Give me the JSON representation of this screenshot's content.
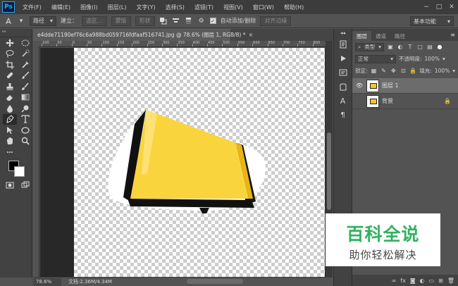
{
  "app": {
    "logo": "Ps",
    "menu": [
      "文件(F)",
      "编辑(E)",
      "图像(I)",
      "图层(L)",
      "文字(Y)",
      "选择(S)",
      "滤镜(T)",
      "视图(V)",
      "窗口(W)",
      "帮助(H)"
    ],
    "window_controls": [
      "−",
      "□",
      "✕"
    ]
  },
  "options_bar": {
    "tool_mode": "路径",
    "make_label": "建立：",
    "selection_btn": "选区...",
    "mask_btn": "蒙版",
    "shape_btn": "形状",
    "auto_add_delete": "自动添加/删除",
    "align_edges": "对齐边缘",
    "workspace": "基本功能"
  },
  "document": {
    "tab_title": "e4dde71190ef76c6a988bd059716fdfaaf516741.jpg @ 78.6% (图层 1, RGB/8) *",
    "zoom": "78.6%",
    "doc_info": "文档:2.36M/4.34M"
  },
  "ruler_ticks": [
    "100",
    "50",
    "0",
    "50",
    "100",
    "150",
    "200",
    "250",
    "300",
    "350",
    "400",
    "450",
    "500",
    "550",
    "600",
    "650",
    "700",
    "750",
    "800"
  ],
  "toolbar": {
    "tools": [
      "move-icon",
      "marquee-icon",
      "lasso-icon",
      "quick-select-icon",
      "crop-icon",
      "eyedropper-icon",
      "healing-icon",
      "brush-icon",
      "stamp-icon",
      "history-brush-icon",
      "eraser-icon",
      "gradient-icon",
      "blur-icon",
      "dodge-icon",
      "pen-icon",
      "type-icon",
      "path-select-icon",
      "ellipse-icon",
      "hand-icon",
      "zoom-icon"
    ]
  },
  "layers_panel": {
    "tabs": [
      "图层",
      "通道",
      "路径"
    ],
    "filter_kind": "类型",
    "blend_mode": "正常",
    "opacity_label": "不透明度:",
    "opacity_value": "100%",
    "lock_label": "锁定:",
    "fill_label": "填充:",
    "fill_value": "100%",
    "layers": [
      {
        "name": "图层 1",
        "visible": true,
        "selected": true
      },
      {
        "name": "背景",
        "visible": false,
        "selected": false,
        "locked": true
      }
    ]
  },
  "watermark": {
    "title": "百科全说",
    "subtitle": "助你轻松解决"
  },
  "colors": {
    "accent_yellow": "#f6c624",
    "watermark_green": "#30b25f"
  }
}
